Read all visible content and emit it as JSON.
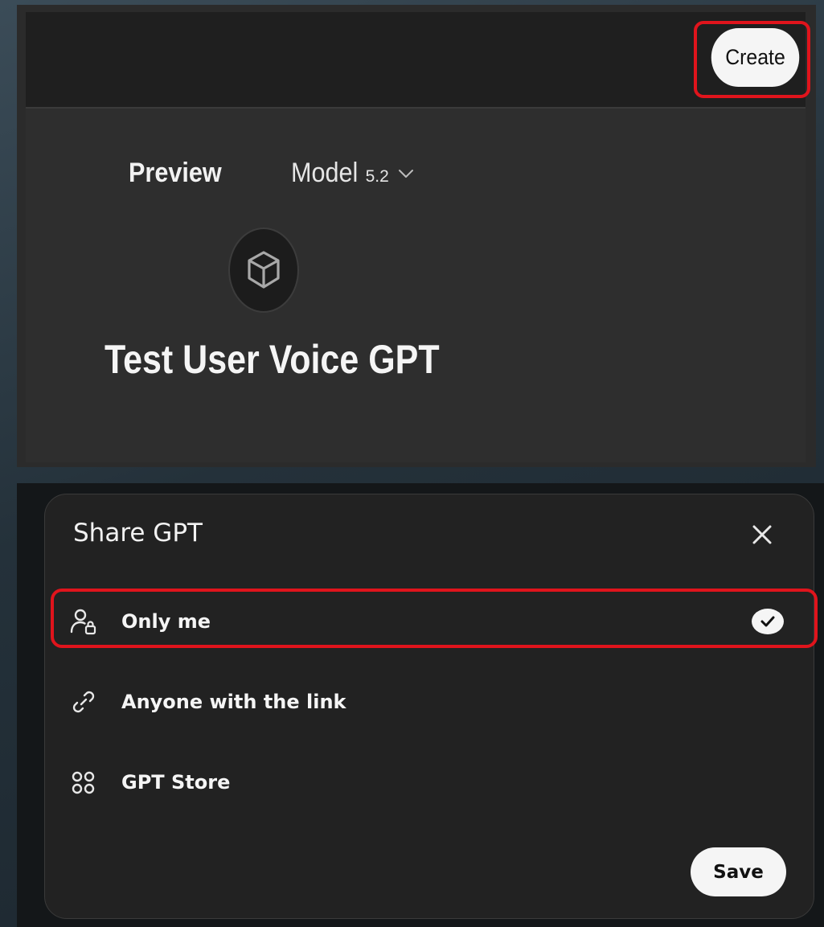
{
  "builder": {
    "create_label": "Create",
    "preview_label": "Preview",
    "model_label": "Model",
    "model_version": "5.2",
    "gpt_name": "Test User Voice GPT",
    "avatar_icon": "cube-icon",
    "model_dropdown_icon": "chevron-down-icon"
  },
  "share_dialog": {
    "title": "Share GPT",
    "close_icon": "close-icon",
    "options": [
      {
        "label": "Only me",
        "icon": "user-lock-icon",
        "selected": true
      },
      {
        "label": "Anyone with the link",
        "icon": "link-icon",
        "selected": false
      },
      {
        "label": "GPT Store",
        "icon": "grid-circles-icon",
        "selected": false
      }
    ],
    "save_label": "Save"
  },
  "colors": {
    "highlight": "#e0141c",
    "button_bg": "#f5f5f5",
    "dialog_bg": "#222222"
  }
}
